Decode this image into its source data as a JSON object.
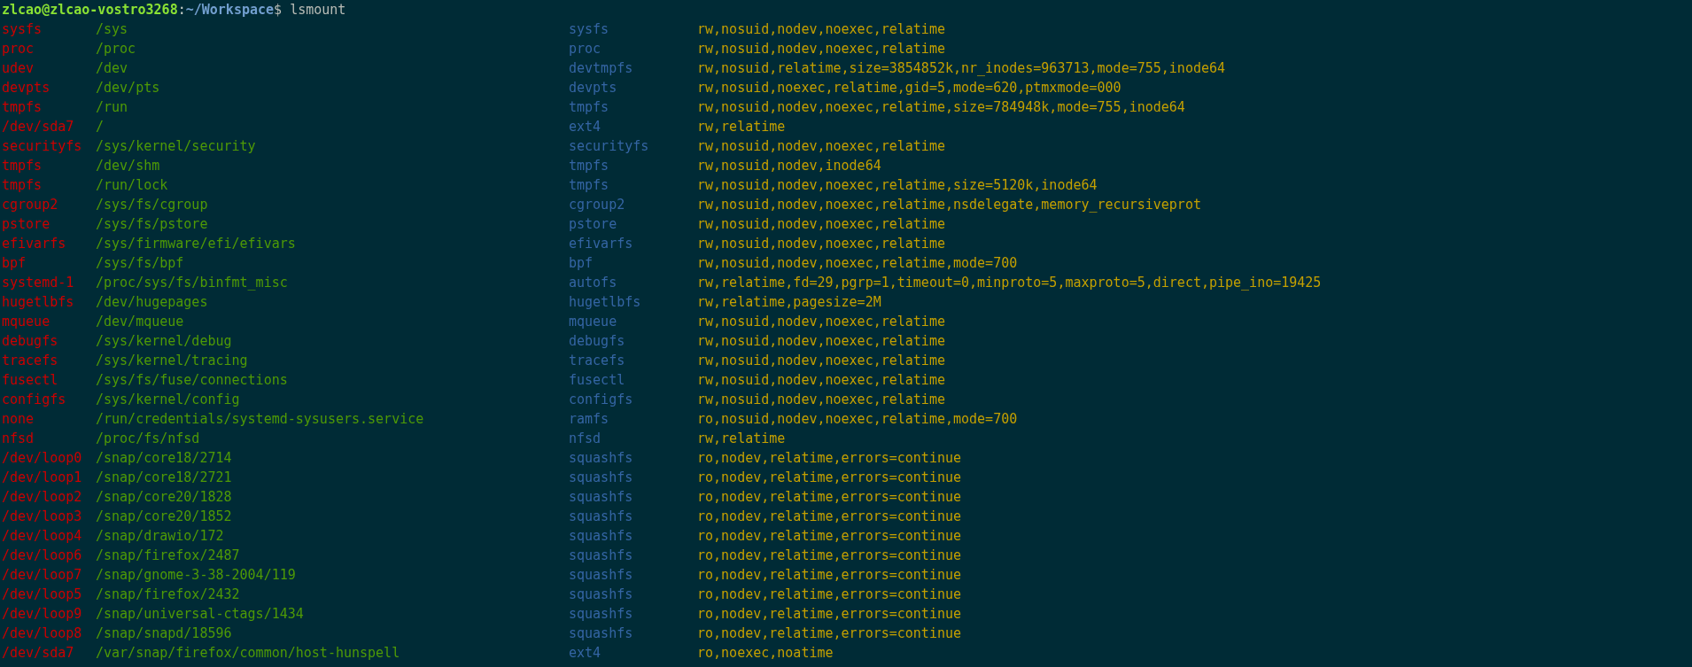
{
  "prompt": {
    "user_host": "zlcao@zlcao-vostro3268",
    "separator": ":",
    "path": "~/Workspace",
    "symbol": "$",
    "command": "lsmount"
  },
  "mounts": [
    {
      "source": "sysfs",
      "target": "/sys",
      "fstype": "sysfs",
      "options": "rw,nosuid,nodev,noexec,relatime"
    },
    {
      "source": "proc",
      "target": "/proc",
      "fstype": "proc",
      "options": "rw,nosuid,nodev,noexec,relatime"
    },
    {
      "source": "udev",
      "target": "/dev",
      "fstype": "devtmpfs",
      "options": "rw,nosuid,relatime,size=3854852k,nr_inodes=963713,mode=755,inode64"
    },
    {
      "source": "devpts",
      "target": "/dev/pts",
      "fstype": "devpts",
      "options": "rw,nosuid,noexec,relatime,gid=5,mode=620,ptmxmode=000"
    },
    {
      "source": "tmpfs",
      "target": "/run",
      "fstype": "tmpfs",
      "options": "rw,nosuid,nodev,noexec,relatime,size=784948k,mode=755,inode64"
    },
    {
      "source": "/dev/sda7",
      "target": "/",
      "fstype": "ext4",
      "options": "rw,relatime"
    },
    {
      "source": "securityfs",
      "target": "/sys/kernel/security",
      "fstype": "securityfs",
      "options": "rw,nosuid,nodev,noexec,relatime"
    },
    {
      "source": "tmpfs",
      "target": "/dev/shm",
      "fstype": "tmpfs",
      "options": "rw,nosuid,nodev,inode64"
    },
    {
      "source": "tmpfs",
      "target": "/run/lock",
      "fstype": "tmpfs",
      "options": "rw,nosuid,nodev,noexec,relatime,size=5120k,inode64"
    },
    {
      "source": "cgroup2",
      "target": "/sys/fs/cgroup",
      "fstype": "cgroup2",
      "options": "rw,nosuid,nodev,noexec,relatime,nsdelegate,memory_recursiveprot"
    },
    {
      "source": "pstore",
      "target": "/sys/fs/pstore",
      "fstype": "pstore",
      "options": "rw,nosuid,nodev,noexec,relatime"
    },
    {
      "source": "efivarfs",
      "target": "/sys/firmware/efi/efivars",
      "fstype": "efivarfs",
      "options": "rw,nosuid,nodev,noexec,relatime"
    },
    {
      "source": "bpf",
      "target": "/sys/fs/bpf",
      "fstype": "bpf",
      "options": "rw,nosuid,nodev,noexec,relatime,mode=700"
    },
    {
      "source": "systemd-1",
      "target": "/proc/sys/fs/binfmt_misc",
      "fstype": "autofs",
      "options": "rw,relatime,fd=29,pgrp=1,timeout=0,minproto=5,maxproto=5,direct,pipe_ino=19425"
    },
    {
      "source": "hugetlbfs",
      "target": "/dev/hugepages",
      "fstype": "hugetlbfs",
      "options": "rw,relatime,pagesize=2M"
    },
    {
      "source": "mqueue",
      "target": "/dev/mqueue",
      "fstype": "mqueue",
      "options": "rw,nosuid,nodev,noexec,relatime"
    },
    {
      "source": "debugfs",
      "target": "/sys/kernel/debug",
      "fstype": "debugfs",
      "options": "rw,nosuid,nodev,noexec,relatime"
    },
    {
      "source": "tracefs",
      "target": "/sys/kernel/tracing",
      "fstype": "tracefs",
      "options": "rw,nosuid,nodev,noexec,relatime"
    },
    {
      "source": "fusectl",
      "target": "/sys/fs/fuse/connections",
      "fstype": "fusectl",
      "options": "rw,nosuid,nodev,noexec,relatime"
    },
    {
      "source": "configfs",
      "target": "/sys/kernel/config",
      "fstype": "configfs",
      "options": "rw,nosuid,nodev,noexec,relatime"
    },
    {
      "source": "none",
      "target": "/run/credentials/systemd-sysusers.service",
      "fstype": "ramfs",
      "options": "ro,nosuid,nodev,noexec,relatime,mode=700"
    },
    {
      "source": "nfsd",
      "target": "/proc/fs/nfsd",
      "fstype": "nfsd",
      "options": "rw,relatime"
    },
    {
      "source": "/dev/loop0",
      "target": "/snap/core18/2714",
      "fstype": "squashfs",
      "options": "ro,nodev,relatime,errors=continue"
    },
    {
      "source": "/dev/loop1",
      "target": "/snap/core18/2721",
      "fstype": "squashfs",
      "options": "ro,nodev,relatime,errors=continue"
    },
    {
      "source": "/dev/loop2",
      "target": "/snap/core20/1828",
      "fstype": "squashfs",
      "options": "ro,nodev,relatime,errors=continue"
    },
    {
      "source": "/dev/loop3",
      "target": "/snap/core20/1852",
      "fstype": "squashfs",
      "options": "ro,nodev,relatime,errors=continue"
    },
    {
      "source": "/dev/loop4",
      "target": "/snap/drawio/172",
      "fstype": "squashfs",
      "options": "ro,nodev,relatime,errors=continue"
    },
    {
      "source": "/dev/loop6",
      "target": "/snap/firefox/2487",
      "fstype": "squashfs",
      "options": "ro,nodev,relatime,errors=continue"
    },
    {
      "source": "/dev/loop7",
      "target": "/snap/gnome-3-38-2004/119",
      "fstype": "squashfs",
      "options": "ro,nodev,relatime,errors=continue"
    },
    {
      "source": "/dev/loop5",
      "target": "/snap/firefox/2432",
      "fstype": "squashfs",
      "options": "ro,nodev,relatime,errors=continue"
    },
    {
      "source": "/dev/loop9",
      "target": "/snap/universal-ctags/1434",
      "fstype": "squashfs",
      "options": "ro,nodev,relatime,errors=continue"
    },
    {
      "source": "/dev/loop8",
      "target": "/snap/snapd/18596",
      "fstype": "squashfs",
      "options": "ro,nodev,relatime,errors=continue"
    },
    {
      "source": "/dev/sda7",
      "target": "/var/snap/firefox/common/host-hunspell",
      "fstype": "ext4",
      "options": "ro,noexec,noatime"
    }
  ]
}
